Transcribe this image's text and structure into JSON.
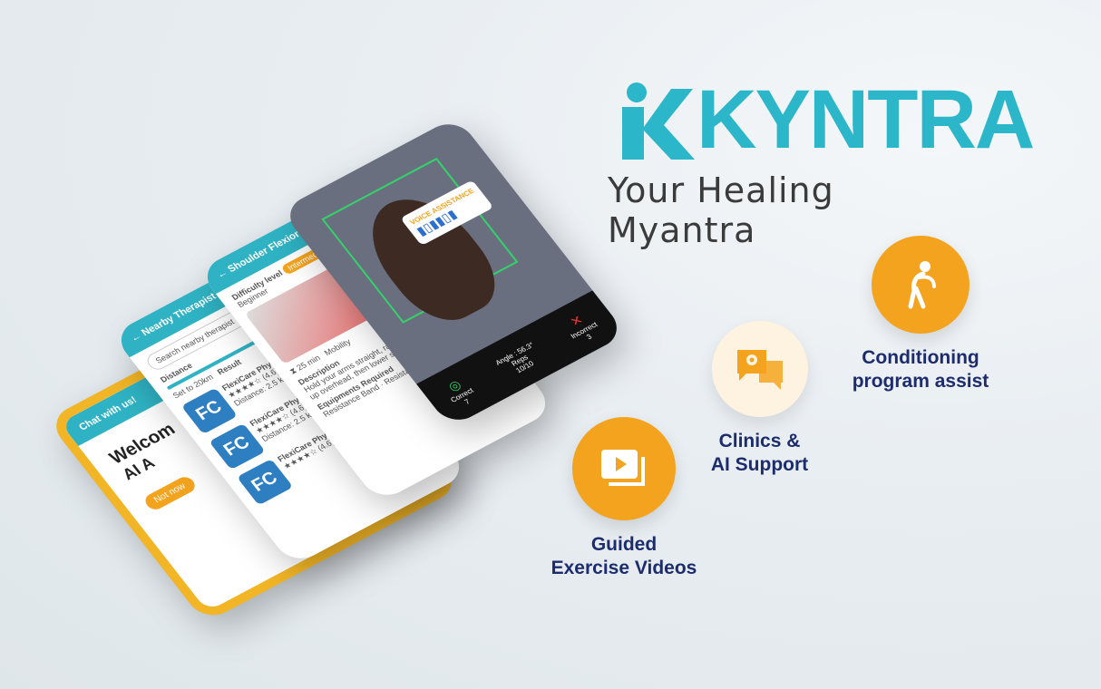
{
  "brand": {
    "name": "KYNTRA",
    "tagline": "Your Healing Myantra",
    "accent": "#2bb6c9",
    "orange": "#f4a31e",
    "navy": "#1c2c6d"
  },
  "features": [
    {
      "label_line1": "Conditioning",
      "label_line2": "program assist",
      "icon": "stretching-person-icon"
    },
    {
      "label_line1": "Clinics &",
      "label_line2": "AI Support",
      "icon": "map-pin-chat-icon"
    },
    {
      "label_line1": "Guided",
      "label_line2": "Exercise Videos",
      "icon": "video-play-icon"
    }
  ],
  "phones": {
    "chat": {
      "header": "Chat with us!",
      "welcome": "Welcom",
      "ai": "AI A",
      "button": "Not now"
    },
    "therapist": {
      "header": "Nearby Therapist",
      "search_placeholder": "Search nearby therapist",
      "distance_label": "Distance",
      "distance_value": "Set to 20km",
      "result_label": "Result",
      "clinics": [
        {
          "initials": "FC",
          "name": "FlexiCare Physiotherapy",
          "rating": "★★★★☆ (4.6)",
          "distance": "Distance: 2.5 km"
        },
        {
          "initials": "FC",
          "name": "FlexiCare Physiotherapy",
          "rating": "★★★★☆ (4.6)",
          "distance": "Distance: 2.5 km"
        },
        {
          "initials": "FC",
          "name": "FlexiCare Physiotherapy",
          "rating": "★★★★☆ (4.6)",
          "distance": ""
        }
      ]
    },
    "exercise": {
      "header": "Shoulder Flexion",
      "difficulty_label": "Difficulty level",
      "difficulty_value": "Beginner",
      "level_badge": "Intermediate",
      "duration": "25 min",
      "category": "Mobility",
      "description_title": "Description",
      "description": "Hold your arms straight, raise them forward and up overhead, then lower slowly.",
      "equipment_title": "Equipments Required",
      "equip_1": "Resistance Band",
      "equip_2": "Resistance Band"
    },
    "camera": {
      "voice_label": "VOICE ASSISTANCE",
      "angle": "Angle : 56.3°",
      "correct": "Correct",
      "reps": "Reps",
      "reps_value": "10/10",
      "incorrect": "Incorrect",
      "correct_count": "7",
      "incorrect_count": "3"
    }
  }
}
